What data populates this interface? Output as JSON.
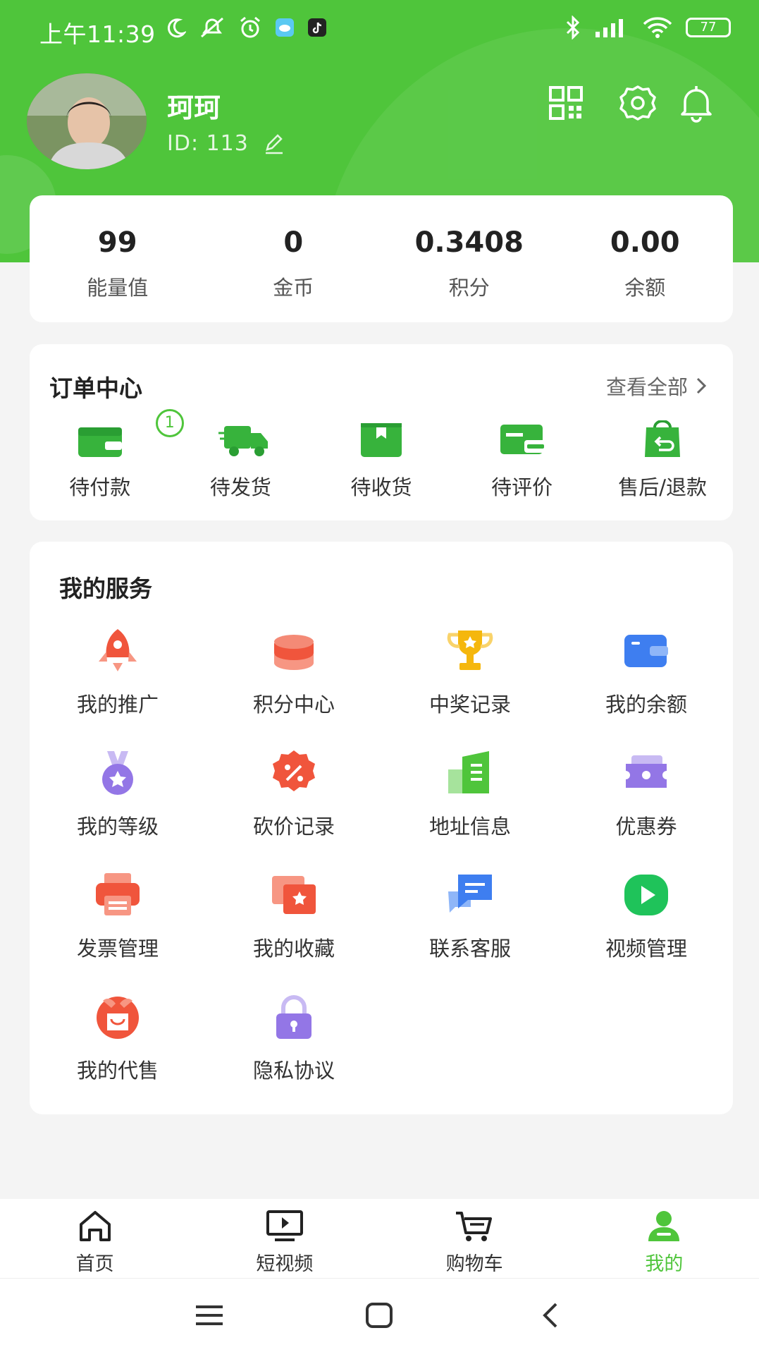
{
  "status_bar": {
    "time": "上午11:39",
    "battery": "77",
    "left_icons": [
      "moon-icon",
      "mute-icon",
      "alarm-icon",
      "weather-app-icon",
      "tiktok-icon"
    ],
    "right_icons": [
      "bluetooth-icon",
      "signal-icon",
      "wifi-icon",
      "battery-icon"
    ]
  },
  "profile": {
    "name": "珂珂",
    "id_text": "ID: 113",
    "actions": [
      "qr-code-icon",
      "settings-icon",
      "bell-icon"
    ]
  },
  "stats": [
    {
      "value": "99",
      "label": "能量值"
    },
    {
      "value": "0",
      "label": "金币"
    },
    {
      "value": "0.3408",
      "label": "积分"
    },
    {
      "value": "0.00",
      "label": "余额"
    }
  ],
  "orders": {
    "title": "订单中心",
    "view_all": "查看全部",
    "items": [
      {
        "label": "待付款",
        "icon": "wallet-icon",
        "badge": "1"
      },
      {
        "label": "待发货",
        "icon": "truck-icon"
      },
      {
        "label": "待收货",
        "icon": "package-icon"
      },
      {
        "label": "待评价",
        "icon": "review-card-icon"
      },
      {
        "label": "售后/退款",
        "icon": "refund-bag-icon"
      }
    ]
  },
  "services": {
    "title": "我的服务",
    "items": [
      {
        "label": "我的推广",
        "icon": "rocket-icon",
        "color": "#f0553c"
      },
      {
        "label": "积分中心",
        "icon": "coins-icon",
        "color": "#f0553c"
      },
      {
        "label": "中奖记录",
        "icon": "trophy-icon",
        "color": "#f5b70d"
      },
      {
        "label": "我的余额",
        "icon": "wallet-blue-icon",
        "color": "#3e7ef0"
      },
      {
        "label": "我的等级",
        "icon": "medal-icon",
        "color": "#9376e6"
      },
      {
        "label": "砍价记录",
        "icon": "discount-badge-icon",
        "color": "#f0553c"
      },
      {
        "label": "地址信息",
        "icon": "building-icon",
        "color": "#4fc53b"
      },
      {
        "label": "优惠券",
        "icon": "ticket-icon",
        "color": "#9376e6"
      },
      {
        "label": "发票管理",
        "icon": "invoice-printer-icon",
        "color": "#f0553c"
      },
      {
        "label": "我的收藏",
        "icon": "favorite-folder-icon",
        "color": "#f0553c"
      },
      {
        "label": "联系客服",
        "icon": "chat-bubbles-icon",
        "color": "#3e7ef0"
      },
      {
        "label": "视频管理",
        "icon": "play-circle-icon",
        "color": "#1fc35a"
      },
      {
        "label": "我的代售",
        "icon": "gift-box-icon",
        "color": "#f0553c"
      },
      {
        "label": "隐私协议",
        "icon": "lock-icon",
        "color": "#9376e6"
      }
    ]
  },
  "tabbar": {
    "items": [
      {
        "label": "首页",
        "icon": "home-icon"
      },
      {
        "label": "短视频",
        "icon": "video-screen-icon"
      },
      {
        "label": "购物车",
        "icon": "cart-icon"
      },
      {
        "label": "我的",
        "icon": "user-icon",
        "active": true
      }
    ]
  },
  "colors": {
    "accent": "#4fc53b",
    "background": "#f4f4f4"
  }
}
